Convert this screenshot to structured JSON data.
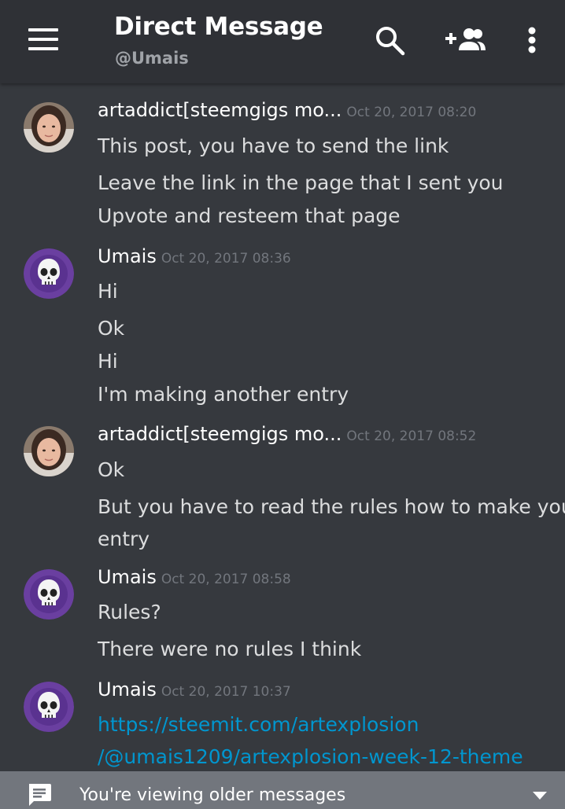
{
  "header": {
    "title": "Direct Message",
    "subtitle": "@Umais"
  },
  "icons": {
    "menu": "hamburger-menu-icon",
    "search": "search-icon",
    "add_friend": "add-friend-icon",
    "more": "more-vertical-icon",
    "chat": "chat-bubble-icon",
    "dropdown": "caret-down-icon"
  },
  "colors": {
    "background": "#36393e",
    "header": "#2f3136",
    "link": "#0096cf",
    "timestamp": "#72767d",
    "footer": "#72767d",
    "umais_avatar": "#6a3fa0"
  },
  "messages": [
    {
      "author": "artaddict[steemgigs mo...",
      "time": "Oct 20, 2017 08:20",
      "lines": [
        "This post, you have to send the link",
        "Leave the link in the page that I sent you",
        "Upvote and resteem that page"
      ]
    },
    {
      "author": "Umais",
      "time": "Oct 20, 2017 08:36",
      "lines": [
        "Hi",
        "Ok",
        "Hi",
        "I'm making another entry"
      ]
    },
    {
      "author": "artaddict[steemgigs mo...",
      "time": "Oct 20, 2017 08:52",
      "lines": [
        "Ok",
        "But you have to read the rules how to make your",
        "entry"
      ]
    },
    {
      "author": "Umais",
      "time": "Oct 20, 2017 08:58",
      "lines": [
        "Rules?",
        "There were no rules I think"
      ]
    },
    {
      "author": "Umais",
      "time": "Oct 20, 2017 10:37",
      "lines": [
        "https://steemit.com/artexplosion",
        "/@umais1209/artexplosion-week-12-theme"
      ]
    }
  ],
  "footer": {
    "text": "You're viewing older messages"
  }
}
